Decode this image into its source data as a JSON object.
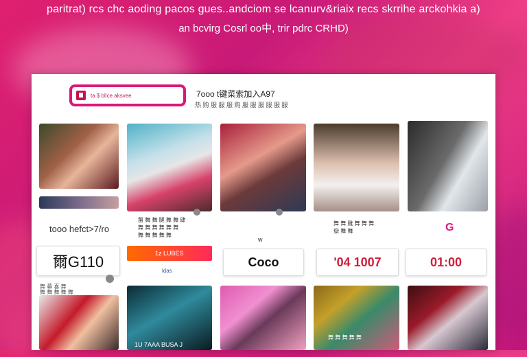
{
  "banner": {
    "line1": "paritrat) rcs chc aoding pacos gues..andciom se lcanurv&riaix recs skrrihe arckohkia a)",
    "line2": "an bcvirg Cosrl oo中, trir pdrc CRHD)"
  },
  "toolbar": {
    "search_value": "ta $ bllce aksvee",
    "title": "7ooo t键菜索加入A97",
    "subtitle": "热 购 服 服 服 购 服 服 服 服 服 服"
  },
  "row1": [
    {
      "caption": "",
      "sub": "tooo hefct>7/ro"
    },
    {
      "caption": "",
      "sub": "盤 舞 舞 腿 舞 舞 肆\n舞 舞 舞 舞 舞 舞\n舞 舞 舞 舞 舞"
    },
    {
      "caption": "",
      "sub": "w"
    },
    {
      "caption": "",
      "sub": "舞 舞 雞 舞 舞 舞\n嶽 舞 舞"
    },
    {
      "caption": "",
      "sub": "G"
    }
  ],
  "row1_labels": [
    {
      "text": "爾G110",
      "sub": "舞 幕 喜 舞"
    },
    {
      "text": "1z LUBES",
      "sub": "ldas"
    },
    {
      "text": "Coco"
    },
    {
      "text": "'04 1007"
    },
    {
      "text": "01:00"
    }
  ],
  "row2": [
    {
      "caption": "舞 舞 舞 舞 舞"
    },
    {
      "caption": "1U 7AAA BUSA J"
    },
    {
      "caption": ""
    },
    {
      "caption": "舞 舞 舞 舞 舞"
    },
    {
      "caption": ""
    }
  ],
  "colors": {
    "accent": "#d9187a",
    "bg": "#e0206f",
    "orange": "#ff5a1f"
  }
}
